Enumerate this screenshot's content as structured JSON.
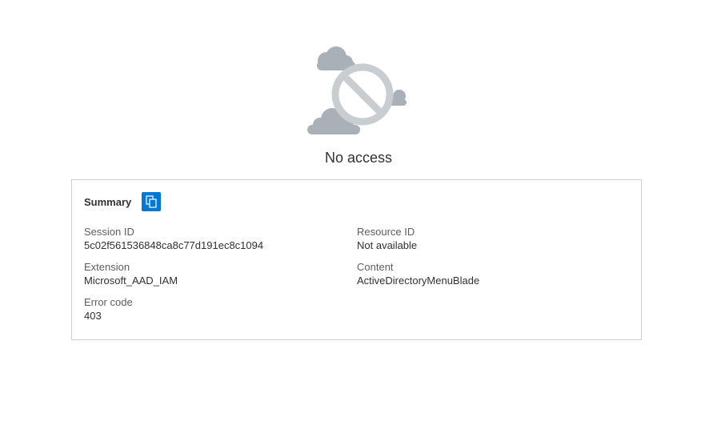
{
  "status": {
    "headline": "No access",
    "illustration_icon": "blocked-cloud-icon"
  },
  "summary": {
    "title": "Summary",
    "copy_icon": "copy-icon",
    "accent_color": "#0078d4",
    "fields": [
      {
        "label": "Session ID",
        "value": "5c02f561536848ca8c77d191ec8c1094"
      },
      {
        "label": "Resource ID",
        "value": "Not available"
      },
      {
        "label": "Extension",
        "value": "Microsoft_AAD_IAM"
      },
      {
        "label": "Content",
        "value": "ActiveDirectoryMenuBlade"
      },
      {
        "label": "Error code",
        "value": "403"
      }
    ]
  }
}
